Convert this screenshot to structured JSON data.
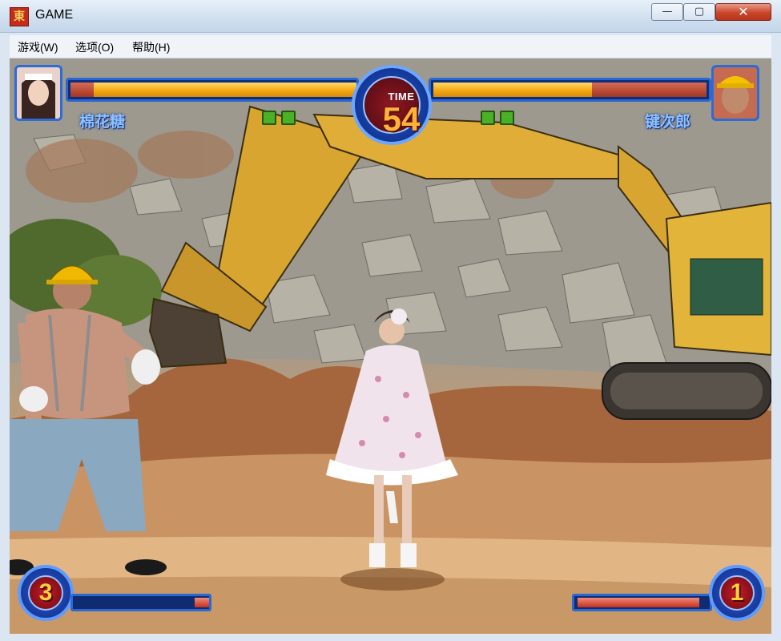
{
  "window": {
    "title": "GAME",
    "icon_glyph": "東",
    "controls": {
      "minimize": "—",
      "maximize": "▢",
      "close": "✕"
    }
  },
  "menu": [
    {
      "label": "游戏(W)"
    },
    {
      "label": "选项(O)"
    },
    {
      "label": "帮助(H)"
    }
  ],
  "hud": {
    "timer_label": "TIME",
    "timer_value": "54",
    "player1": {
      "name": "棉花糖",
      "health_fraction": 0.92,
      "round_wins": 2,
      "power_stock": "3",
      "power_fraction": 0.11
    },
    "player2": {
      "name": "键次郎",
      "health_fraction": 0.57,
      "round_wins": 2,
      "power_stock": "1",
      "power_fraction": 0.92
    }
  },
  "scene": {
    "description_icons": [
      "excavator-icon",
      "rock-quarry-background"
    ]
  },
  "colors": {
    "health": "#f3a914",
    "frame_blue": "#2b67d3",
    "timer_digits": "#ffb23a",
    "player_name": "#8fc2ff"
  }
}
